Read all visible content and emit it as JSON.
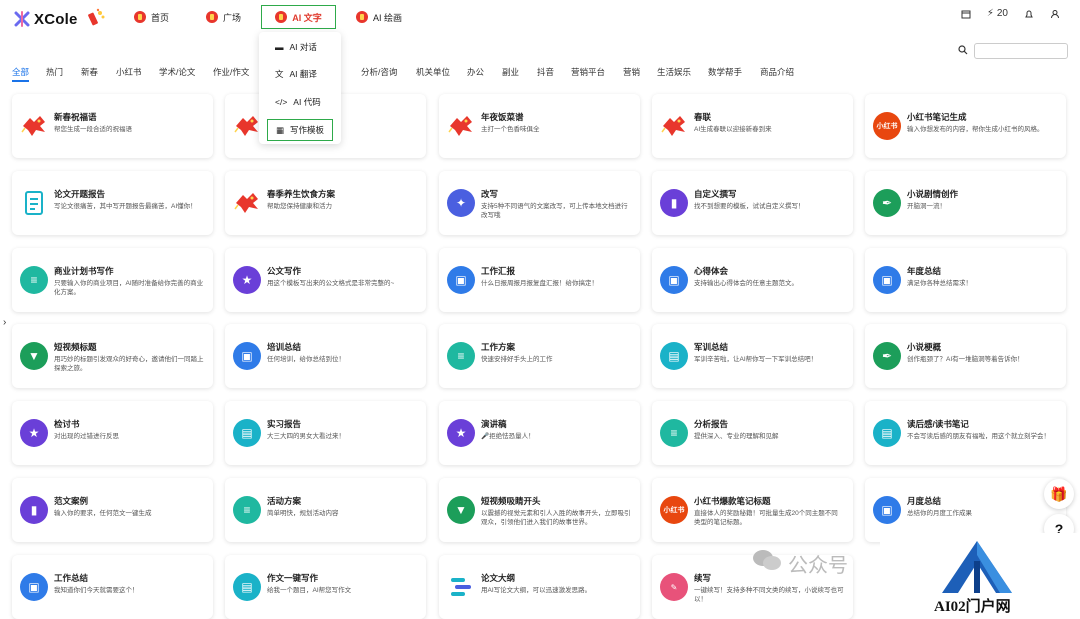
{
  "header": {
    "logo_text": "XCole",
    "nav": [
      {
        "label": "首页"
      },
      {
        "label": "广场"
      },
      {
        "label": "AI 文字",
        "active": true
      },
      {
        "label": "AI 绘画"
      }
    ],
    "points": "20"
  },
  "dropdown": {
    "items": [
      {
        "label": "AI 对话",
        "icon": "chat-icon"
      },
      {
        "label": "AI 翻译",
        "icon": "translate-icon"
      },
      {
        "label": "AI 代码",
        "icon": "code-icon"
      },
      {
        "label": "写作模板",
        "icon": "template-icon",
        "active": true
      }
    ]
  },
  "categories": [
    "全部",
    "热门",
    "新春",
    "小红书",
    "学术/论文",
    "作业/作文",
    "",
    "分析/咨询",
    "机关单位",
    "办公",
    "副业",
    "抖音",
    "营销平台",
    "营销",
    "生活娱乐",
    "数学帮手",
    "商品介绍"
  ],
  "cards": [
    {
      "title": "新春祝福语",
      "desc": "帮您生成一段合适的祝福语",
      "icon": "dragon-icon",
      "color": "#e8362c"
    },
    {
      "title": "",
      "desc": "",
      "icon": "dragon-icon",
      "color": "#e8362c"
    },
    {
      "title": "年夜饭菜谱",
      "desc": "主打一个色香味俱全",
      "icon": "dragon-icon",
      "color": "#e8362c"
    },
    {
      "title": "春联",
      "desc": "AI生成春联以迎接新春到来",
      "icon": "dragon-icon",
      "color": "#e8362c"
    },
    {
      "title": "小红书笔记生成",
      "desc": "输入你想发布的内容，帮你生成小红书的风格。",
      "icon": "xiaohongshu-icon",
      "color": "#e8470f",
      "badge": "小红书"
    },
    {
      "title": "论文开题报告",
      "desc": "写论文很痛苦，其中写开题报告最痛苦，AI懂你！",
      "icon": "document-icon",
      "color": "#1ab2c8"
    },
    {
      "title": "春季养生饮食方案",
      "desc": "帮助您保持健康和活力",
      "icon": "dragon-icon",
      "color": "#e8362c"
    },
    {
      "title": "改写",
      "desc": "支持5种不同语气的文案改写，可上传本地文档进行改写哦",
      "icon": "magic-wand-icon",
      "color": "#4a5fe0"
    },
    {
      "title": "自定义撰写",
      "desc": "找不到想要的模板，试试自定义撰写！",
      "icon": "book-icon",
      "color": "#6a3fd8"
    },
    {
      "title": "小说剧情创作",
      "desc": "开脑洞一流！",
      "icon": "pen-icon",
      "color": "#1c9e5a"
    },
    {
      "title": "商业计划书写作",
      "desc": "只要输入你的商业项目，AI随时准备给你完善的商业化方案。",
      "icon": "doc-lines-icon",
      "color": "#1fb8a0"
    },
    {
      "title": "公文写作",
      "desc": "用这个模板写出来的公文格式是非常完整的~",
      "icon": "star-badge-icon",
      "color": "#6a3fd8"
    },
    {
      "title": "工作汇报",
      "desc": "什么日报周报月报复盘汇报！给你搞定！",
      "icon": "briefcase-icon",
      "color": "#2f7be8"
    },
    {
      "title": "心得体会",
      "desc": "支持输出心得体会的任意主题范文。",
      "icon": "briefcase-icon",
      "color": "#2f7be8"
    },
    {
      "title": "年度总结",
      "desc": "满足你各种总结需求！",
      "icon": "briefcase-icon",
      "color": "#2f7be8"
    },
    {
      "title": "短视频标题",
      "desc": "用巧妙的标题引发观众的好奇心，邀请他们一同踏上探索之旅。",
      "icon": "tie-icon",
      "color": "#1c9e5a"
    },
    {
      "title": "培训总结",
      "desc": "任何培训，给你总结到位！",
      "icon": "briefcase-icon",
      "color": "#2f7be8"
    },
    {
      "title": "工作方案",
      "desc": "快速安排好手头上的工作",
      "icon": "doc-lines-icon",
      "color": "#1fb8a0"
    },
    {
      "title": "军训总结",
      "desc": "军训辛苦啦，让AI帮你写一下军训总结吧！",
      "icon": "id-card-icon",
      "color": "#1ab2c8"
    },
    {
      "title": "小说梗概",
      "desc": "创作瓶颈了？AI有一堆脑洞等着告诉你！",
      "icon": "pen-icon",
      "color": "#1c9e5a"
    },
    {
      "title": "检讨书",
      "desc": "对出现的过错进行反思",
      "icon": "star-badge-icon",
      "color": "#6a3fd8"
    },
    {
      "title": "实习报告",
      "desc": "大三大四的男女大看过来！",
      "icon": "id-card-icon",
      "color": "#1ab2c8"
    },
    {
      "title": "演讲稿",
      "desc": "🎤拒绝怯恐量人！",
      "icon": "star-badge-icon",
      "color": "#6a3fd8"
    },
    {
      "title": "分析报告",
      "desc": "提供深入、专业的理解和见解",
      "icon": "doc-lines-icon",
      "color": "#1fb8a0"
    },
    {
      "title": "读后感/读书笔记",
      "desc": "不会写读后感的朋友有福啦，用这个就立刻学会！",
      "icon": "id-card-icon",
      "color": "#1ab2c8"
    },
    {
      "title": "范文案例",
      "desc": "输入你的要求，任何范文一键生成",
      "icon": "book-icon",
      "color": "#6a3fd8"
    },
    {
      "title": "活动方案",
      "desc": "简单明快，规划活动内容",
      "icon": "doc-lines-icon",
      "color": "#1fb8a0"
    },
    {
      "title": "短视频吸睛开头",
      "desc": "以震撼的视觉元素和引人入胜的故事开头，立即吸引观众，引领他们进入我们的故事世界。",
      "icon": "tie-icon",
      "color": "#1c9e5a"
    },
    {
      "title": "小红书爆款笔记标题",
      "desc": "直接体人的奖励秘籍！可批量生成20个同主题不同类型的笔记标题。",
      "icon": "xiaohongshu-icon",
      "color": "#e8470f",
      "badge": "小红书"
    },
    {
      "title": "月度总结",
      "desc": "总结你的月度工作成果",
      "icon": "briefcase-icon",
      "color": "#2f7be8"
    },
    {
      "title": "工作总结",
      "desc": "我知道你们今天就需要这个！",
      "icon": "briefcase-icon",
      "color": "#2f7be8"
    },
    {
      "title": "作文一键写作",
      "desc": "给我一个题目，AI帮您写作文",
      "icon": "id-card-icon",
      "color": "#1ab2c8"
    },
    {
      "title": "论文大纲",
      "desc": "用AI写论文大纲，可以迅速激发思路。",
      "icon": "outline-icon",
      "color": "#1ab2c8"
    },
    {
      "title": "续写",
      "desc": "一键续写！支持多种不同文类的续写，小说续写也可以！",
      "icon": "pen-edit-icon",
      "color": "#e8527a"
    },
    {
      "title": "",
      "desc": "",
      "icon": "",
      "color": "#fff"
    }
  ],
  "watermark": {
    "text": "公众号",
    "logo_text": "AI02门户网"
  }
}
